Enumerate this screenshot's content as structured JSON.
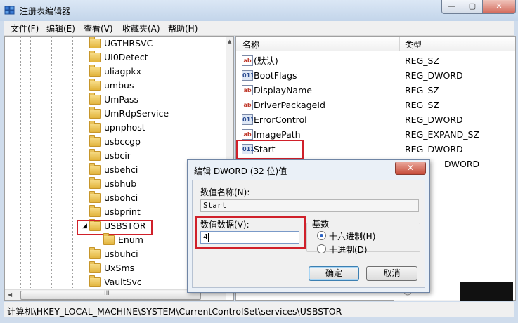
{
  "window": {
    "title": "注册表编辑器",
    "controls": {
      "minimize": "—",
      "maximize": "▢",
      "close": "✕"
    }
  },
  "menu": [
    "文件(F)",
    "编辑(E)",
    "查看(V)",
    "收藏夹(A)",
    "帮助(H)"
  ],
  "tree": {
    "items": [
      "UGTHRSVC",
      "UI0Detect",
      "uliagpkx",
      "umbus",
      "UmPass",
      "UmRdpService",
      "upnphost",
      "usbccgp",
      "usbcir",
      "usbehci",
      "usbhub",
      "usbohci",
      "usbprint",
      "USBSTOR",
      "Enum",
      "usbuhci",
      "UxSms",
      "VaultSvc"
    ],
    "selected": "USBSTOR",
    "expander": "◢",
    "hscroll_grip": "III"
  },
  "values": {
    "columns": {
      "name": "名称",
      "type": "类型"
    },
    "rows": [
      {
        "icon": "ab",
        "name": "(默认)",
        "type": "REG_SZ"
      },
      {
        "icon": "bin",
        "name": "BootFlags",
        "type": "REG_DWORD"
      },
      {
        "icon": "ab",
        "name": "DisplayName",
        "type": "REG_SZ"
      },
      {
        "icon": "ab",
        "name": "DriverPackageId",
        "type": "REG_SZ"
      },
      {
        "icon": "bin",
        "name": "ErrorControl",
        "type": "REG_DWORD"
      },
      {
        "icon": "ab",
        "name": "ImagePath",
        "type": "REG_EXPAND_SZ"
      },
      {
        "icon": "bin",
        "name": "Start",
        "type": "REG_DWORD"
      },
      {
        "icon": "bin",
        "name": "",
        "type": "DWORD"
      }
    ],
    "icon_labels": {
      "ab": "ab",
      "bin": "011"
    }
  },
  "status": "计算机\\HKEY_LOCAL_MACHINE\\SYSTEM\\CurrentControlSet\\services\\USBSTOR",
  "dialog": {
    "title": "编辑 DWORD (32 位)值",
    "close": "✕",
    "name_label": "数值名称(N):",
    "name_value": "Start",
    "data_label": "数值数据(V):",
    "data_value": "4",
    "base_label": "基数",
    "hex_label": "十六进制(H)",
    "dec_label": "十进制(D)",
    "base_selected": "hex",
    "ok": "确定",
    "cancel": "取消"
  }
}
